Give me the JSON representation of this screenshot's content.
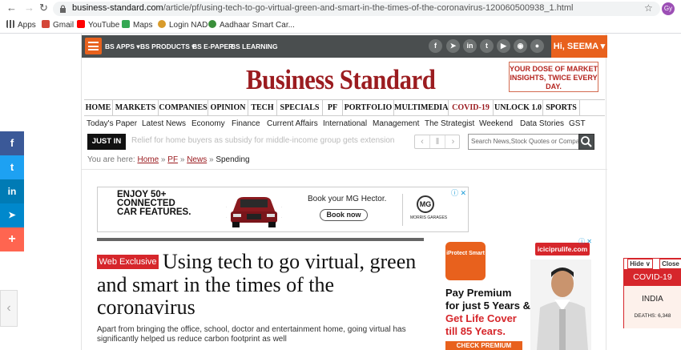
{
  "browser": {
    "url_domain": "business-standard.com",
    "url_path": "/article/pf/using-tech-to-go-virtual-green-and-smart-in-the-times-of-the-coronavirus-120060500938_1.html",
    "profile_initial": "Gy",
    "bookmarks": [
      "Apps",
      "Gmail",
      "YouTube",
      "Maps",
      "Login NAD",
      "Aadhaar Smart Car..."
    ]
  },
  "header": {
    "menu_items": [
      "BS APPS ▾",
      "BS PRODUCTS ▾",
      "BS E-PAPER",
      "BS LEARNING"
    ],
    "social_icons": [
      "facebook-icon",
      "telegram-icon",
      "linkedin-icon",
      "twitter-icon",
      "youtube-icon",
      "rss-icon",
      "notification-icon"
    ],
    "greeting": "Hi, SEEMA ▾",
    "logo": "Business Standard",
    "promo": "YOUR DOSE OF MARKET INSIGHTS, TWICE EVERY DAY."
  },
  "main_nav": [
    "HOME",
    "MARKETS",
    "COMPANIES",
    "OPINION",
    "TECH",
    "SPECIALS",
    "PF",
    "PORTFOLIO",
    "MULTIMEDIA",
    "COVID-19",
    "UNLOCK 1.0",
    "SPORTS"
  ],
  "sub_nav": [
    "Today's Paper",
    "Latest News",
    "Economy",
    "Finance",
    "Current Affairs",
    "International",
    "Management",
    "The Strategist",
    "Weekend",
    "Data Stories",
    "GST"
  ],
  "ticker": {
    "label": "JUST IN",
    "headline": "Relief for home buyers as subsidy for middle-income group gets extension"
  },
  "search": {
    "placeholder": "Search News,Stock Quotes or Companies"
  },
  "breadcrumb": {
    "prefix": "You are here:",
    "items": [
      "Home",
      "PF",
      "News"
    ],
    "current": "Spending"
  },
  "ad_banner": {
    "headline": "ENJOY 50+ CONNECTED CAR FEATURES.",
    "line1": "ENJOY 50+",
    "line2": "CONNECTED",
    "line3": "CAR FEATURES.",
    "offer": "Book your MG Hector.",
    "cta": "Book now",
    "brand": "MORRIS GARAGES",
    "brand_short": "MG"
  },
  "article": {
    "badge": "Web Exclusive",
    "title": "Using tech to go virtual, green and smart in the times of the coronavirus",
    "deck": "Apart from bringing the office, school, doctor and entertainment home, going virtual has significantly helped us reduce carbon footprint as well"
  },
  "side_ad": {
    "badge": "iProtect Smart",
    "brand": "iciciprulife.com",
    "line1": "Pay Premium",
    "line2": "for just 5 Years &",
    "line3": "Get Life Cover",
    "line4": "till 85 Years.",
    "cta": "CHECK PREMIUM"
  },
  "share_rail": {
    "items": [
      {
        "icon": "facebook-icon",
        "glyph": "f",
        "color": "#3b5998"
      },
      {
        "icon": "twitter-icon",
        "glyph": "t",
        "color": "#1da1f2"
      },
      {
        "icon": "linkedin-icon",
        "glyph": "in",
        "color": "#007bb5"
      },
      {
        "icon": "telegram-icon",
        "glyph": "➤",
        "color": "#0088cc"
      },
      {
        "icon": "more-icon",
        "glyph": "+",
        "color": "#ff6550"
      }
    ]
  },
  "covid_widget": {
    "hide": "Hide ∨",
    "close": "Close",
    "title": "COVID-19",
    "country": "INDIA",
    "deaths": "DEATHS: 6,348"
  }
}
